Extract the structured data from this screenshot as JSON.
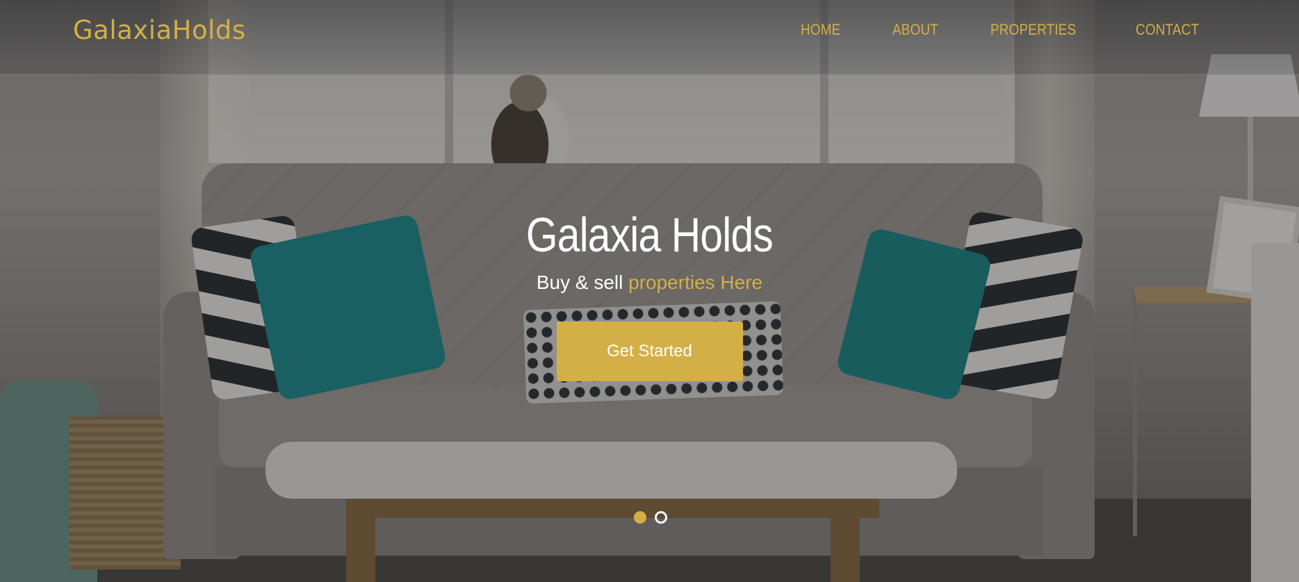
{
  "brand": {
    "logo_text": "GalaxiaHolds"
  },
  "nav": {
    "items": [
      {
        "label": "HOME"
      },
      {
        "label": "ABOUT"
      },
      {
        "label": "PROPERTIES"
      },
      {
        "label": "CONTACT"
      }
    ]
  },
  "hero": {
    "title": "Galaxia Holds",
    "subtitle_plain": "Buy & sell",
    "subtitle_accent": "properties Here",
    "cta_label": "Get Started",
    "carousel": {
      "slide_count": 2,
      "active_index": 0
    }
  },
  "colors": {
    "accent": "#d4af46",
    "text_light": "#ffffff",
    "overlay": "rgba(20,20,22,0.36)"
  },
  "icons": {
    "carousel_indicator_active": "filled-circle",
    "carousel_indicator_inactive": "hollow-circle"
  }
}
